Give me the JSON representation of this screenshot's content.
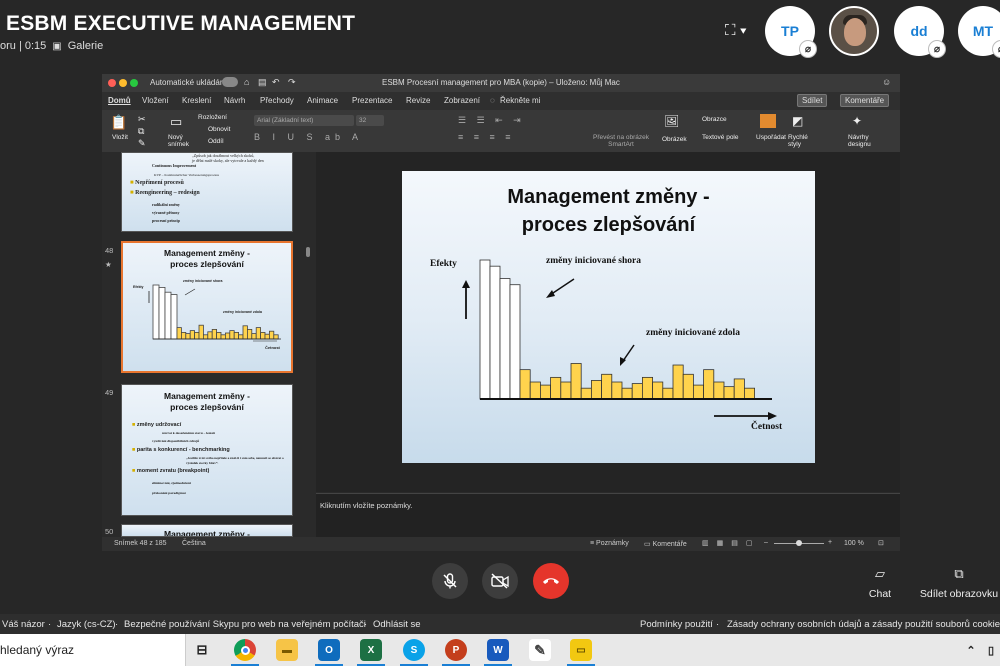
{
  "skype": {
    "title": "ESBM EXECUTIVE MANAGEMENT",
    "call_info": "oru | 0:15",
    "gallery_label": "Galerie",
    "participants": [
      {
        "initials": "TP"
      },
      {
        "initials": ""
      },
      {
        "initials": "dd"
      },
      {
        "initials": "MT"
      }
    ],
    "chat_label": "Chat",
    "share_label": "Sdílet obrazovku"
  },
  "ppt": {
    "autosave_label": "Automatické ukládání",
    "autosave_state": "Vyp",
    "window_title": "ESBM Procesní management pro MBA (kopie) – Uloženo: Můj Mac",
    "tabs": [
      "Domů",
      "Vložení",
      "Kreslení",
      "Návrh",
      "Přechody",
      "Animace",
      "Prezentace",
      "Revize",
      "Zobrazení",
      "Řekněte mi"
    ],
    "share_button": "Sdílet",
    "comments_button": "Komentáře",
    "ribbon": {
      "paste": "Vložit",
      "new_slide": "Nový snímek",
      "layout": "Rozložení",
      "reset": "Obnovit",
      "section": "Oddíl",
      "font_name": "Arial (Základní text)",
      "font_size": "32",
      "smartart": "Převést na obrázek SmartArt",
      "picture": "Obrázek",
      "shapes": "Obrazce",
      "textbox": "Textové pole",
      "arrange": "Uspořádat",
      "quick_styles": "Rychlé styly",
      "designer": "Návrhy designu"
    },
    "thumbnails": [
      {
        "number": "",
        "lines": [
          "„Způsob jak dosáhnout velkých skoků,",
          "je dělat malé skoky, ale vytrvale a každý den",
          "Continuous Improvement",
          "KVP – Kontinuierlicher Verbesserungsprozess",
          "Nepřímení procesů",
          "Reengineering – redesign",
          "radikální změny",
          "výrazné přínosy",
          "procesní princip"
        ]
      },
      {
        "number": "48",
        "title": "Management změny - proces zlepšování",
        "labels": [
          "Efekty",
          "změny iniciované shora",
          "změny iniciované zdola",
          "Četnost"
        ]
      },
      {
        "number": "49",
        "title": "Management změny - proces zlepšování",
        "lines": [
          "změny udržovací",
          "návrat k dosaženému stavu – kázeň",
          "využívání disponibilních zdrojů",
          "parita s konkurencí - benchmarking",
          "„Jestliže zváš svého nepřítele a znáš-li i sám sebe, nemusíš se obávat o výsledek stovky bitev“.",
          "moment zvratu (breakpoint)",
          "eliminování, zjednodušení",
          "překonání paradigmat"
        ]
      },
      {
        "number": "50",
        "title": "Management změny -"
      }
    ],
    "slide": {
      "title_line1": "Management změny -",
      "title_line2": "proces zlepšování",
      "y_label": "Efekty",
      "top_label": "změny iniciované shora",
      "bottom_label": "změny iniciované zdola",
      "x_label": "Četnost"
    },
    "notes_placeholder": "Kliknutím vložíte poznámky.",
    "status": {
      "slide_counter": "Snímek 48 z 185",
      "language": "Čeština",
      "notes": "Poznámky",
      "comments": "Komentáře",
      "zoom": "100 %"
    }
  },
  "chart_data": {
    "type": "bar",
    "title": "",
    "series": [
      {
        "name": "změny iniciované shora",
        "values": [
          9,
          8.6,
          7.8,
          7.4,
          0,
          0,
          0,
          0,
          0,
          0,
          0,
          0,
          0,
          0,
          0,
          0,
          0,
          0,
          0,
          0,
          0,
          0,
          0,
          0,
          0,
          0,
          0
        ]
      },
      {
        "name": "změny iniciované zdola",
        "values": [
          0,
          0,
          0,
          0,
          1.9,
          1.1,
          0.9,
          1.4,
          1.1,
          2.3,
          0.7,
          1.2,
          1.6,
          1.1,
          0.7,
          1.0,
          1.4,
          1.1,
          0.7,
          2.2,
          1.6,
          0.9,
          1.9,
          1.1,
          0.8,
          1.3,
          0.7
        ]
      }
    ],
    "colors": {
      "top": "#ffffff",
      "bottom": "#ffd34d"
    },
    "xlabel": "Četnost",
    "ylabel": "Efekty"
  },
  "footer": {
    "links": [
      "Váš názor",
      "Jazyk (cs-CZ)",
      "Bezpečné používání Skypu pro web na veřejném počítači",
      "Odhlásit se",
      "Podmínky použití",
      "Zásady ochrany osobních údajů a zásady použití souborů cookie"
    ]
  },
  "taskbar": {
    "search_text": "hledaný výraz",
    "apps": [
      "task-view",
      "chrome",
      "file-explorer",
      "outlook",
      "excel",
      "skype",
      "powerpoint",
      "word",
      "paint",
      "sticky-notes"
    ]
  }
}
